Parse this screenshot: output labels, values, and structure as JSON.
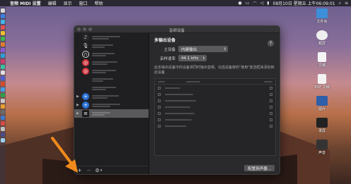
{
  "menubar": {
    "app_name": "音频 MIDI 设置",
    "items": [
      "编辑",
      "显示",
      "窗口",
      "帮助"
    ],
    "datetime": "08月10日 星期五 上午06:09:01"
  },
  "window": {
    "title": "音频设备"
  },
  "panel": {
    "section_title": "多输出设备",
    "help": "?",
    "master_label": "主设备",
    "master_value": "内建输出",
    "rate_label": "采样速率",
    "rate_value": "44.1 kHz",
    "description": "此多输出设备中的设备将同时输出音频。勾选设备旁的\"使用\"复选框来添加到此设备",
    "config_button": "配置扬声器..."
  },
  "sidebar_bottom": {
    "add": "+",
    "remove": "−",
    "gear": "⚙"
  },
  "desktop_icons": [
    {
      "label": "文件夹",
      "color": "#3c8fd8"
    },
    {
      "label": "截屏",
      "color": "#eeeeee"
    },
    {
      "label": "文稿",
      "color": "#f4f4f4"
    },
    {
      "label": "PDF 文稿",
      "color": "#f2f2f2"
    },
    {
      "label": "图片",
      "color": "#2f5fa8"
    },
    {
      "label": "录屏",
      "color": "#222222"
    },
    {
      "label": "声音",
      "color": "#333333"
    }
  ],
  "colors": {
    "accent_red": "#d0303a",
    "accent_blue": "#2a72d8",
    "annotation": "#f08a1c"
  }
}
